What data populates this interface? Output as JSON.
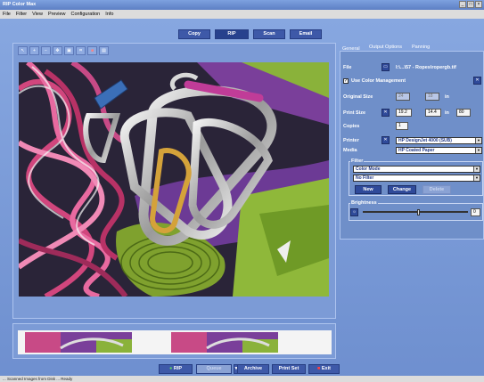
{
  "window": {
    "title": "RIP Color Max"
  },
  "menu": [
    "File",
    "Filter",
    "View",
    "Preview",
    "Configuration",
    "Info"
  ],
  "top_tabs": [
    "Copy",
    "RIP",
    "Scan",
    "Email"
  ],
  "right_panel": {
    "tabs": [
      "General",
      "Output Options",
      "Panning"
    ],
    "file_label": "File",
    "file_value": "I:\\...\\57 - Ropes\\ropergb.tif",
    "use_color_mgmt": "Use Color Management",
    "original_size_label": "Original Size",
    "original_w": "24",
    "original_h": "18",
    "original_unit": "in",
    "print_size_label": "Print Size",
    "print_w": "19.2",
    "print_h": "14.4",
    "print_unit": "in",
    "print_pct": "80",
    "copies_label": "Copies",
    "copies": "1",
    "printer_label": "Printer",
    "printer": "HP DesignJet 4000 (SUB)",
    "media_label": "Media",
    "media": "HP Coated Paper",
    "filter_group": "Filter",
    "filter_mode": "Color Mode",
    "filter_value": "No Filter",
    "filter_new": "New",
    "filter_change": "Change",
    "filter_delete": "Delete",
    "brightness_label": "Brightness",
    "brightness_value": "0"
  },
  "bottom_buttons": [
    "RIP",
    "Queue",
    "Archive",
    "Print Set",
    "Exit"
  ],
  "status": "... Scanned Images from Disk ...  Ready",
  "colors": {
    "accent": "#3e59a8",
    "background": "#6f8fc9"
  }
}
